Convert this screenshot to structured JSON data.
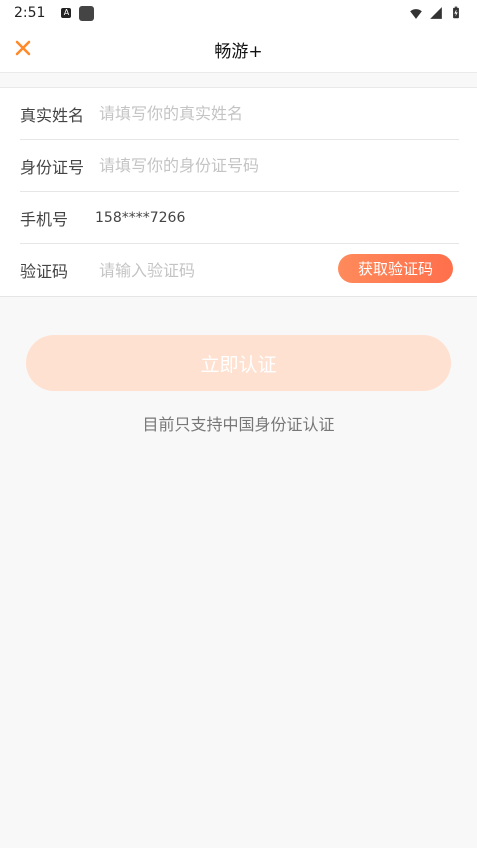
{
  "status_bar": {
    "time": "2:51",
    "a_icon_text": "A"
  },
  "header": {
    "title": "畅游+"
  },
  "form": {
    "name": {
      "label": "真实姓名",
      "placeholder": "请填写你的真实姓名"
    },
    "id_card": {
      "label": "身份证号",
      "placeholder": "请填写你的身份证号码"
    },
    "phone": {
      "label": "手机号",
      "value": "158****7266"
    },
    "code": {
      "label": "验证码",
      "placeholder": "请输入验证码",
      "button_label": "获取验证码"
    }
  },
  "submit_label": "立即认证",
  "notice": "目前只支持中国身份证认证",
  "colors": {
    "accent": "#ff7448",
    "submit_disabled": "#ffe1d1",
    "close_icon": "#ff8a2a"
  }
}
